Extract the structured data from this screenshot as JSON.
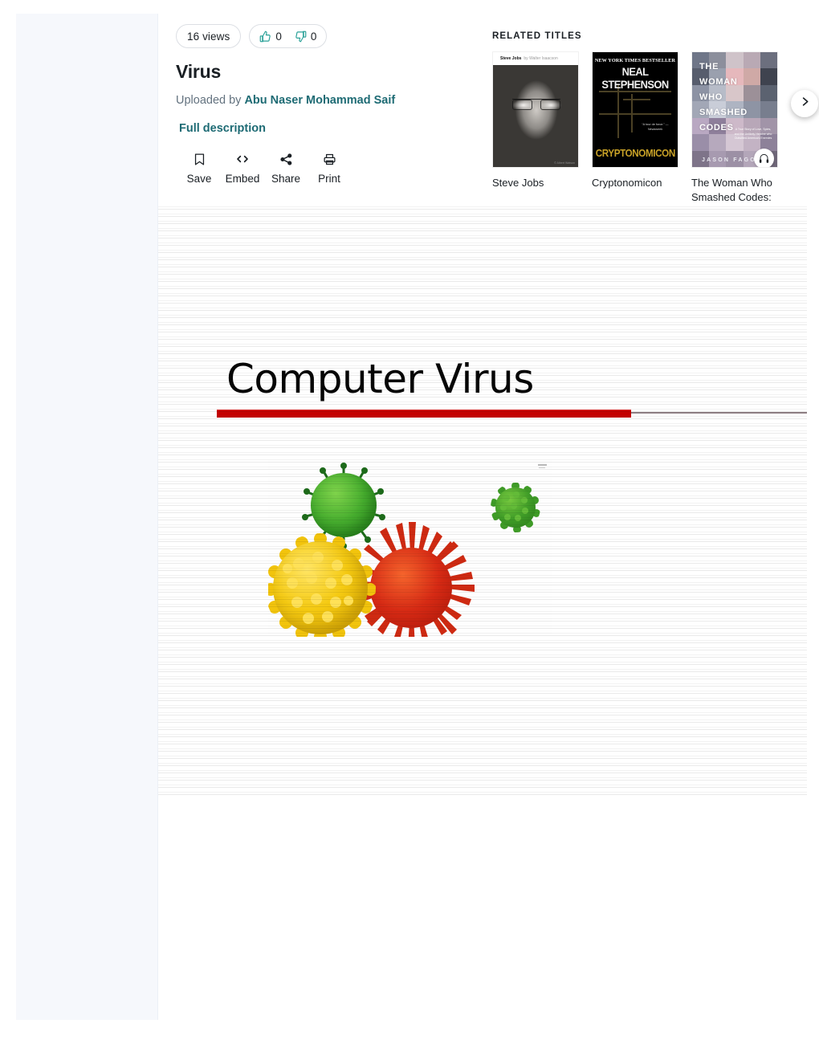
{
  "header": {
    "views_label": "16 views",
    "likes": "0",
    "dislikes": "0",
    "like_icon": "thumbs-up-icon",
    "dislike_icon": "thumbs-down-icon",
    "title": "Virus",
    "uploaded_prefix": "Uploaded by",
    "uploader": "Abu Naser Mohammad Saif",
    "full_description_label": "Full description",
    "accent_color": "#1e6b74",
    "like_color": "#2aa198"
  },
  "actions": [
    {
      "label": "Save",
      "icon": "bookmark-icon"
    },
    {
      "label": "Embed",
      "icon": "code-brackets-icon"
    },
    {
      "label": "Share",
      "icon": "share-nodes-icon"
    },
    {
      "label": "Print",
      "icon": "printer-icon"
    }
  ],
  "related": {
    "heading": "RELATED TITLES",
    "next_icon": "chevron-right-icon",
    "audio_icon": "headphones-icon",
    "items": [
      {
        "title": "Steve Jobs",
        "cover": {
          "style": "steve-jobs",
          "band_title": "Steve Jobs",
          "band_author": "by Walter Isaacson",
          "credit": "© Albert Watson"
        }
      },
      {
        "title": "Cryptonomicon",
        "cover": {
          "style": "cryptonomicon",
          "banner": "NEW YORK TIMES BESTSELLER",
          "author": "NEAL STEPHENSON",
          "blurb": "“A tour de force.” —Newsweek",
          "title_text": "CRYPTONOMICON",
          "title_color": "#c9a227"
        }
      },
      {
        "title": "The Woman Who Smashed Codes: A Tru",
        "cover": {
          "style": "woman-who-smashed-codes",
          "lines": [
            "THE",
            "WOMAN",
            "WHO",
            "SMASHED",
            "CODES"
          ],
          "subtitle": "A True Story of Love, Spies, and the Unlikely Heroine who Outwitted America's Enemies",
          "byline": "JASON FAGONE",
          "has_audio_badge": true
        }
      }
    ]
  },
  "document": {
    "slide_title": "Computer Virus",
    "rule_color": "#c40000",
    "rule_secondary_color": "#8d7d82",
    "illustration": {
      "name": "virus-particles-illustration",
      "particles": [
        {
          "name": "green-virus",
          "color": "#46ad2e"
        },
        {
          "name": "yellow-virus",
          "color": "#f5ca12"
        },
        {
          "name": "red-virus",
          "color": "#d62a14"
        },
        {
          "name": "small-green-virus",
          "color": "#3f9c27"
        }
      ]
    }
  }
}
